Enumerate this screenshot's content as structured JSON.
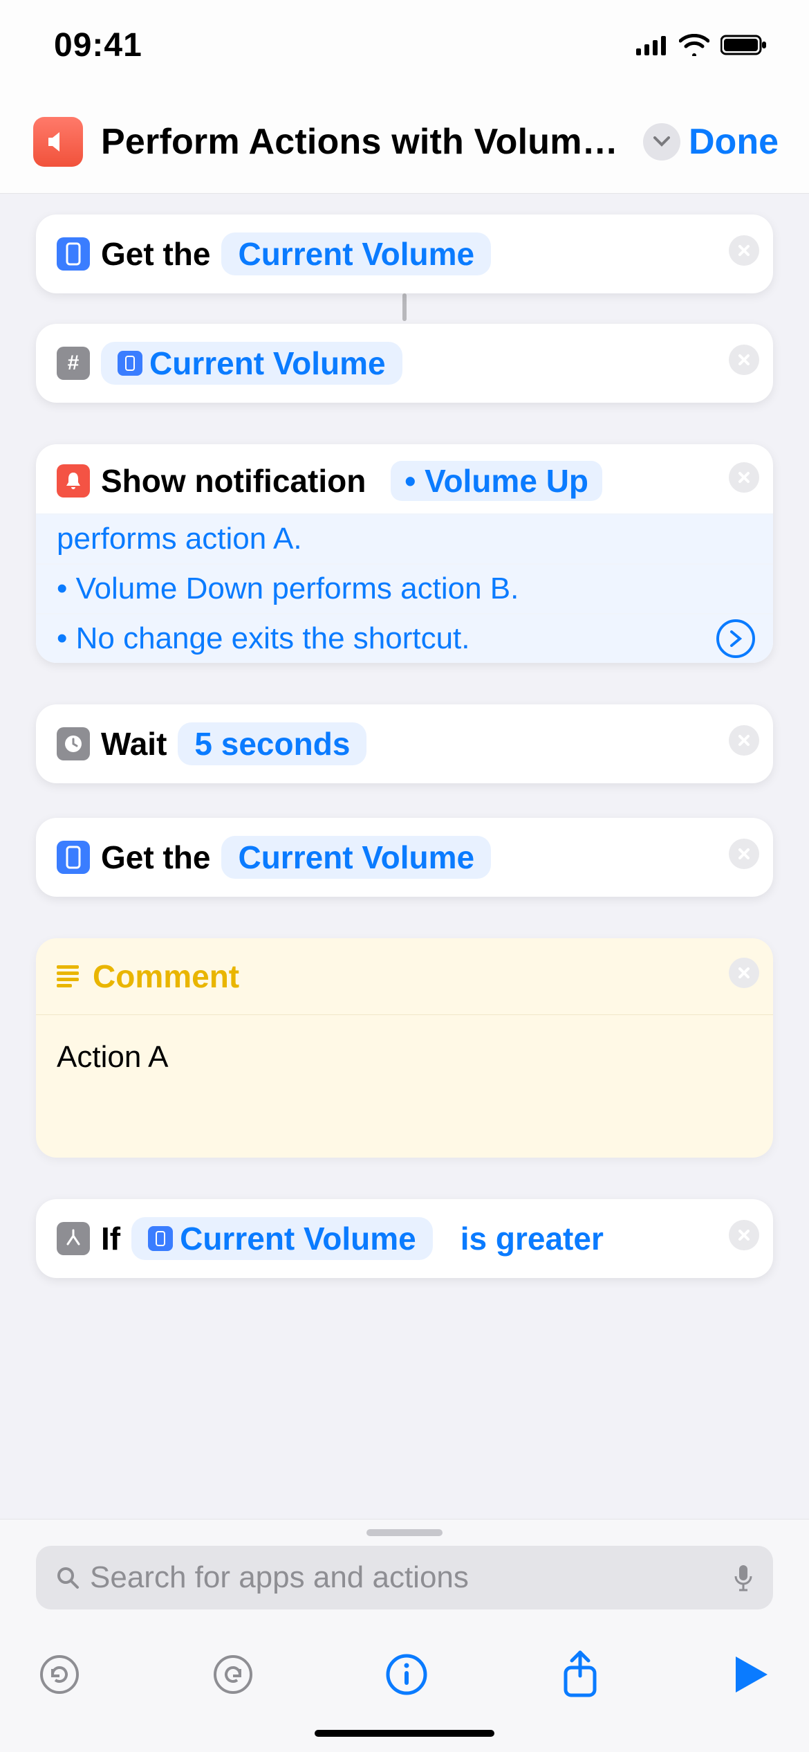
{
  "status": {
    "time": "09:41"
  },
  "header": {
    "title": "Perform Actions with Volume Buttons",
    "done": "Done"
  },
  "actions": {
    "get_volume_1": {
      "label": "Get the",
      "token": "Current Volume"
    },
    "number_variable": {
      "token": "Current Volume"
    },
    "notification": {
      "label": "Show notification",
      "tokens": [
        "• Volume Up",
        "performs action A.",
        "• Volume Down performs action B.",
        "• No change exits the shortcut."
      ]
    },
    "wait": {
      "label": "Wait",
      "token": "5 seconds"
    },
    "get_volume_2": {
      "label": "Get the",
      "token": "Current Volume"
    },
    "comment": {
      "title": "Comment",
      "body": "Action A"
    },
    "if": {
      "label": "If",
      "token": "Current Volume",
      "condition": "is greater"
    }
  },
  "search": {
    "placeholder": "Search for apps and actions"
  }
}
